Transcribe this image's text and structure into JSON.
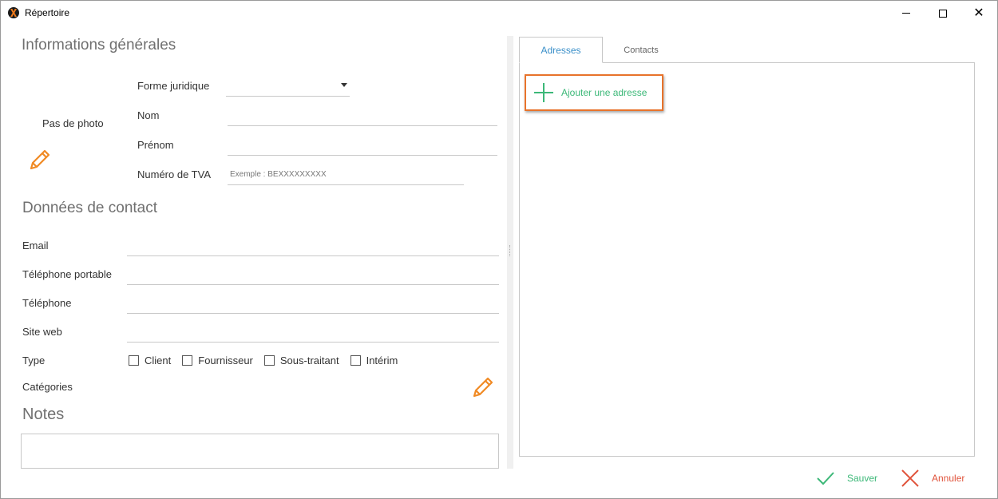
{
  "window": {
    "title": "Répertoire"
  },
  "general": {
    "section_title": "Informations générales",
    "no_photo": "Pas de photo",
    "forme_juridique_label": "Forme juridique",
    "forme_juridique_value": "",
    "nom_label": "Nom",
    "prenom_label": "Prénom",
    "tva_label": "Numéro de TVA",
    "tva_placeholder": "Exemple : BEXXXXXXXXX"
  },
  "contact": {
    "section_title": "Données de contact",
    "email_label": "Email",
    "mobile_label": "Téléphone portable",
    "phone_label": "Téléphone",
    "website_label": "Site web",
    "type_label": "Type",
    "types": [
      "Client",
      "Fournisseur",
      "Sous-traitant",
      "Intérim"
    ],
    "categories_label": "Catégories"
  },
  "notes": {
    "section_title": "Notes"
  },
  "tabs": {
    "addresses": "Adresses",
    "contacts": "Contacts"
  },
  "addresses": {
    "add_label": "Ajouter une adresse"
  },
  "actions": {
    "save": "Sauver",
    "cancel": "Annuler"
  },
  "colors": {
    "accent_green": "#3cb878",
    "accent_red": "#e0533b",
    "accent_orange": "#f08a24",
    "tab_blue": "#3a8fc9",
    "highlight": "#e8732b"
  }
}
